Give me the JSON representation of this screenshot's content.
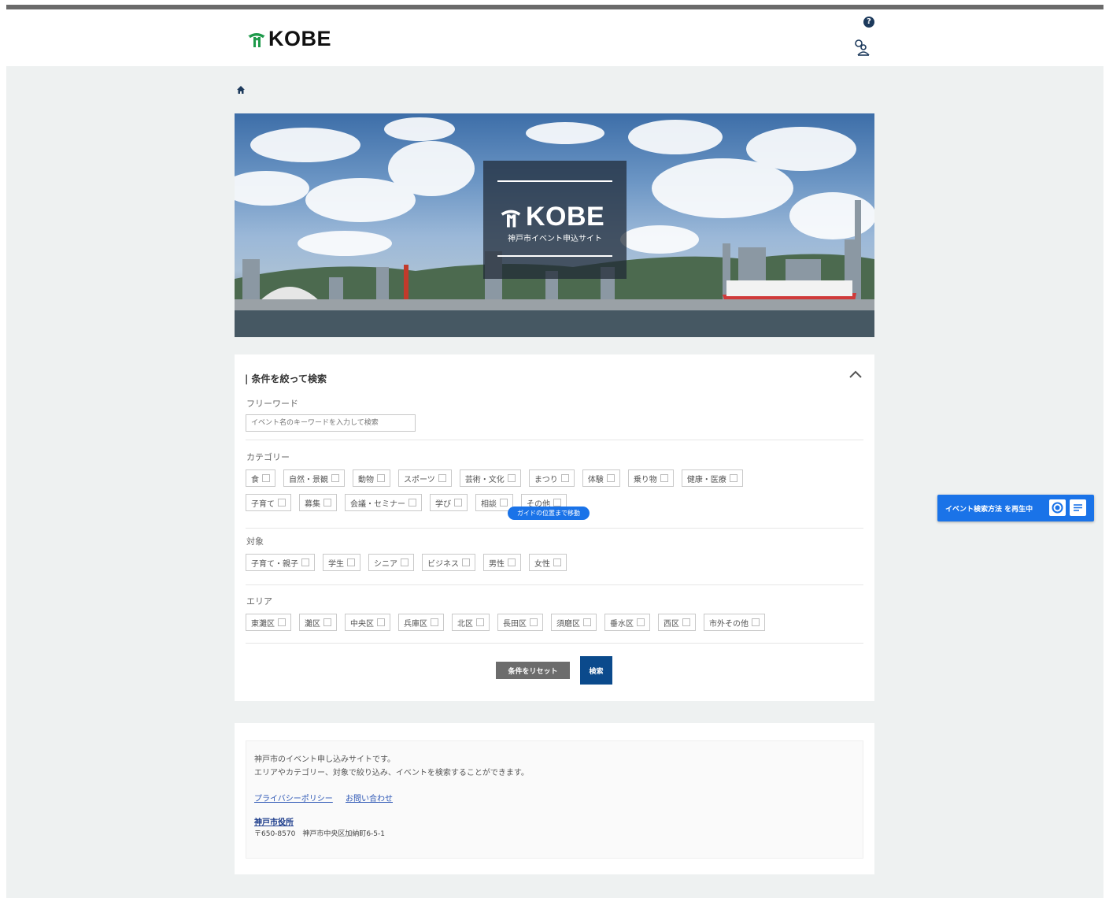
{
  "header": {
    "logo_text": "KOBE",
    "help_icon": "question-circle-icon",
    "user_icon": "user-account-icon"
  },
  "breadcrumb": {
    "home_icon": "home-icon"
  },
  "hero": {
    "logo_text": "KOBE",
    "subtitle": "神戸市イベント申込サイト"
  },
  "search": {
    "title": "| 条件を絞って検索",
    "freeword_label": "フリーワード",
    "freeword_placeholder": "イベント名のキーワードを入力して検索",
    "category_label": "カテゴリー",
    "categories": [
      "食",
      "自然・景観",
      "動物",
      "スポーツ",
      "芸術・文化",
      "まつり",
      "体験",
      "乗り物",
      "健康・医療",
      "子育て",
      "募集",
      "会議・セミナー",
      "学び",
      "相談",
      "その他"
    ],
    "target_label": "対象",
    "targets": [
      "子育て・親子",
      "学生",
      "シニア",
      "ビジネス",
      "男性",
      "女性"
    ],
    "area_label": "エリア",
    "areas": [
      "東灘区",
      "灘区",
      "中央区",
      "兵庫区",
      "北区",
      "長田区",
      "須磨区",
      "垂水区",
      "西区",
      "市外その他"
    ],
    "guide_pill": "ガイドの位置まで移動",
    "reset_label": "条件をリセット",
    "search_label": "検索"
  },
  "floating_banner": {
    "text": "イベント検索方法 を再生中",
    "icons": [
      "record-icon",
      "list-icon"
    ]
  },
  "footer": {
    "desc_line1": "神戸市のイベント申し込みサイトです。",
    "desc_line2": "エリアやカテゴリー、対象で絞り込み、イベントを検索することができます。",
    "privacy_link": "プライバシーポリシー",
    "contact_link": "お問い合わせ",
    "org_name": "神戸市役所",
    "address": "〒650-8570　神戸市中央区加納町6-5-1"
  },
  "colors": {
    "brand_navy": "#0b4a8c",
    "accent_blue": "#1a73e8",
    "page_bg": "#eef1f1",
    "logo_green": "#1e9a4a"
  }
}
